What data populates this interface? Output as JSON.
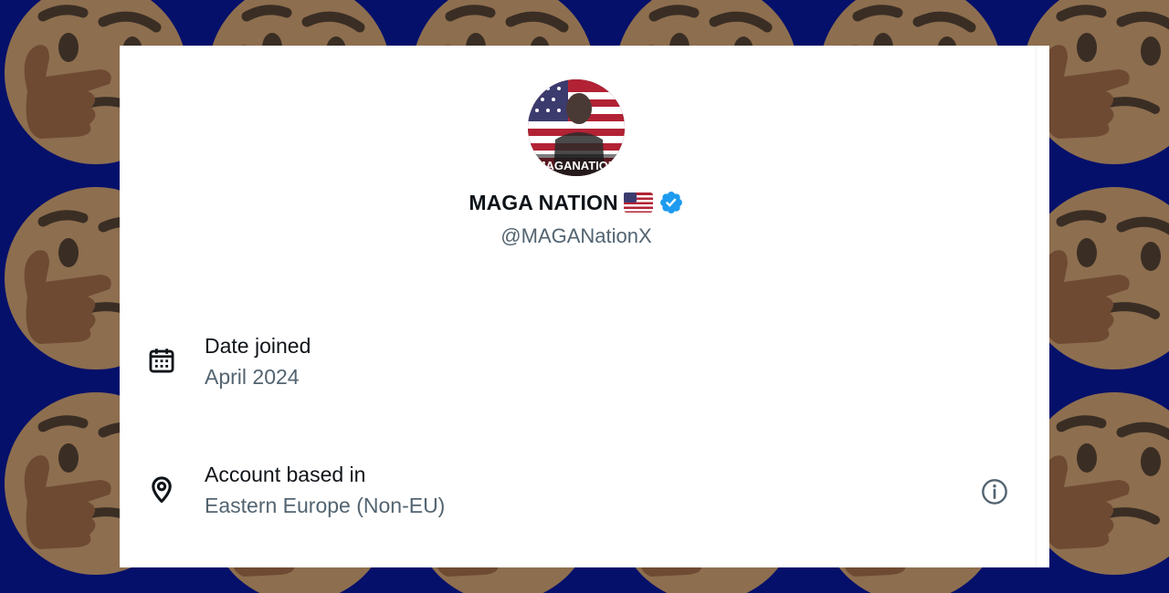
{
  "profile": {
    "display_name": "MAGA NATION",
    "flag_emoji": "flag-us-icon",
    "verified": true,
    "handle": "@MAGANationX",
    "avatar_text": "MAGANATION"
  },
  "about": {
    "date_joined_label": "Date joined",
    "date_joined_value": "April 2024",
    "account_based_label": "Account based in",
    "account_based_value": "Eastern Europe (Non-EU)"
  },
  "colors": {
    "background": "#05106a",
    "card": "#ffffff",
    "verified_badge": "#1d9bf0",
    "secondary_text": "#536471",
    "primary_text": "#0f1419"
  }
}
